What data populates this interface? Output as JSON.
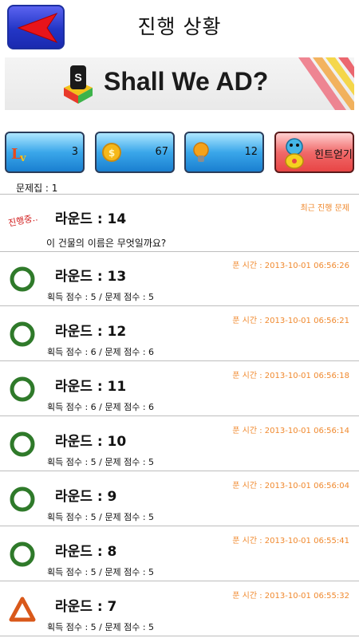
{
  "header": {
    "title": "진행 상황"
  },
  "ad": {
    "text": "Shall We AD?"
  },
  "stats": {
    "level": "3",
    "coins": "67",
    "hints": "12",
    "hint_button_label": "힌트얻기"
  },
  "problem_set": "문제집 : 1",
  "current": {
    "round": "라운드 : 14",
    "status_label": "최근 진행 문제",
    "in_progress_label": "진행중..",
    "question": "이 건물의 이름은 무엇일까요?"
  },
  "rounds": [
    {
      "round": "라운드 : 13",
      "time": "푼 시간 : 2013-10-01 06:56:26",
      "score": "획득 점수 : 5 / 문제 점수 : 5",
      "mark": "circle"
    },
    {
      "round": "라운드 : 12",
      "time": "푼 시간 : 2013-10-01 06:56:21",
      "score": "획득 점수 : 6 / 문제 점수 : 6",
      "mark": "circle"
    },
    {
      "round": "라운드 : 11",
      "time": "푼 시간 : 2013-10-01 06:56:18",
      "score": "획득 점수 : 6 / 문제 점수 : 6",
      "mark": "circle"
    },
    {
      "round": "라운드 : 10",
      "time": "푼 시간 : 2013-10-01 06:56:14",
      "score": "획득 점수 : 5 / 문제 점수 : 5",
      "mark": "circle"
    },
    {
      "round": "라운드 : 9",
      "time": "푼 시간 : 2013-10-01 06:56:04",
      "score": "획득 점수 : 5 / 문제 점수 : 5",
      "mark": "circle"
    },
    {
      "round": "라운드 : 8",
      "time": "푼 시간 : 2013-10-01 06:55:41",
      "score": "획득 점수 : 5 / 문제 점수 : 5",
      "mark": "circle"
    },
    {
      "round": "라운드 : 7",
      "time": "푼 시간 : 2013-10-01 06:55:32",
      "score": "획득 점수 : 5 / 문제 점수 : 5",
      "mark": "triangle"
    }
  ]
}
